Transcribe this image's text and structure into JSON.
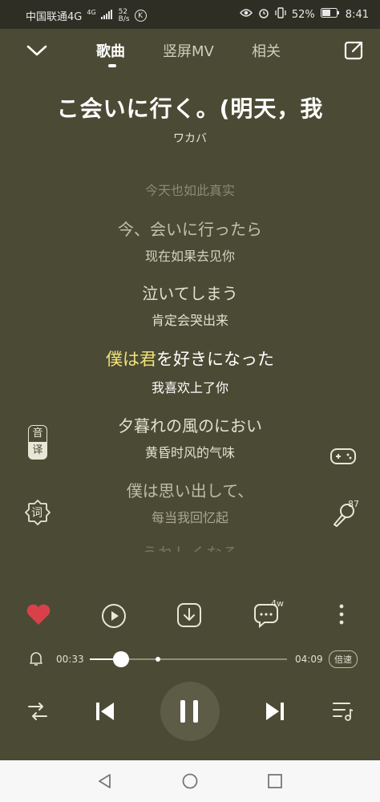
{
  "status": {
    "carrier": "中国联通4G",
    "net_badge": "4G",
    "speed_value": "52",
    "speed_unit": "B/s",
    "k_label": "K",
    "battery": "52%",
    "time": "8:41"
  },
  "tabs": [
    {
      "label": "歌曲"
    },
    {
      "label": "竖屏MV"
    },
    {
      "label": "相关"
    }
  ],
  "song": {
    "title": "こ会いに行く。(明天，我",
    "artist": "ワカバ"
  },
  "lyrics": [
    {
      "jp": "",
      "cn": "今天也如此真实"
    },
    {
      "jp": "今、会いに行ったら",
      "cn": "现在如果去见你"
    },
    {
      "jp": "泣いてしまう",
      "cn": "肯定会哭出来"
    },
    {
      "jp_sung": "僕は君",
      "jp_rest": "を好きになった",
      "cn": "我喜欢上了你"
    },
    {
      "jp": "夕暮れの風のにおい",
      "cn": "黄昏时风的气味"
    },
    {
      "jp": "僕は思い出して、",
      "cn": "每当我回忆起"
    },
    {
      "jp": "うれしくなる",
      "cn": ""
    }
  ],
  "side": {
    "yin": "音",
    "yi": "译",
    "ci": "词",
    "sing_count": "87"
  },
  "actions": {
    "comment_count": "4w"
  },
  "progress": {
    "current": "00:33",
    "total": "04:09",
    "fraction": 0.16,
    "speed_label": "倍速"
  },
  "colors": {
    "bg": "#4b4a34",
    "highlight": "#f0e27a",
    "heart": "#d8404a"
  }
}
